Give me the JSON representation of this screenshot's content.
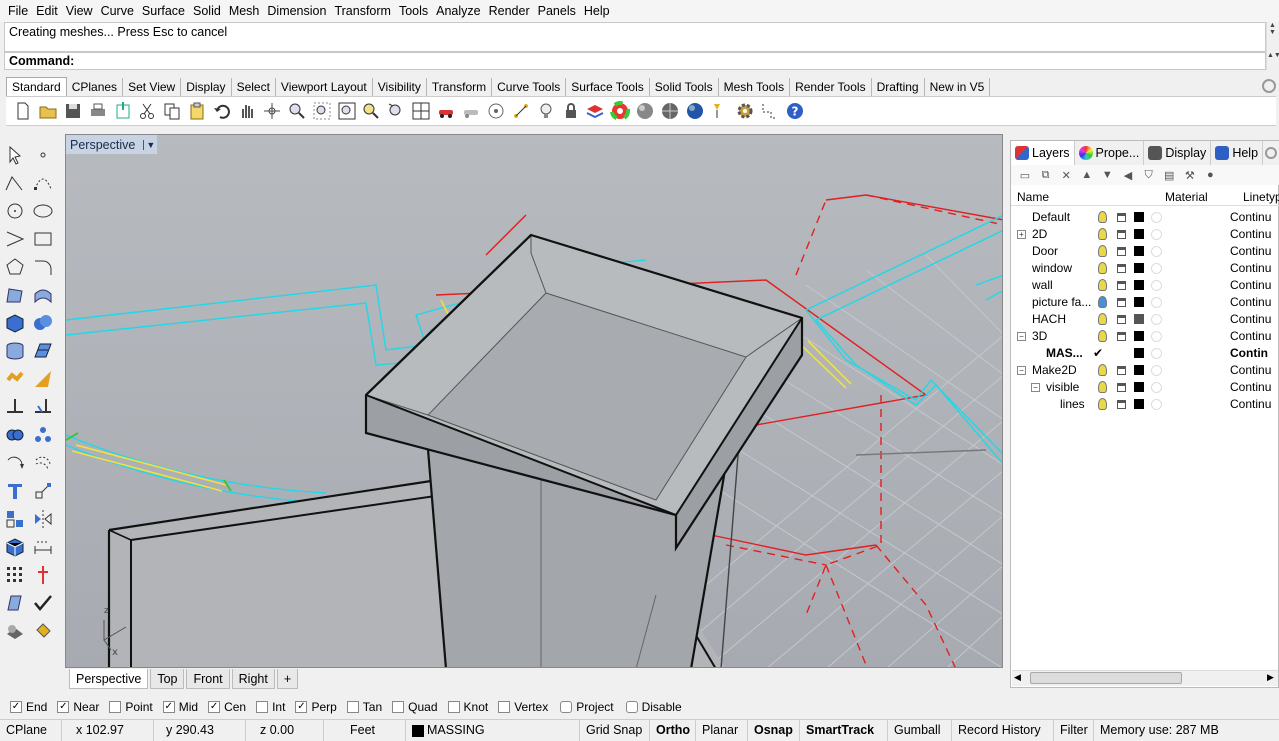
{
  "menu": [
    "File",
    "Edit",
    "View",
    "Curve",
    "Surface",
    "Solid",
    "Mesh",
    "Dimension",
    "Transform",
    "Tools",
    "Analyze",
    "Render",
    "Panels",
    "Help"
  ],
  "command_history": "Creating meshes... Press Esc to cancel",
  "command_prompt": "Command:",
  "toolbar_tabs": [
    "Standard",
    "CPlanes",
    "Set View",
    "Display",
    "Select",
    "Viewport Layout",
    "Visibility",
    "Transform",
    "Curve Tools",
    "Surface Tools",
    "Solid Tools",
    "Mesh Tools",
    "Render Tools",
    "Drafting",
    "New in V5"
  ],
  "viewport": {
    "title": "Perspective",
    "axis_x": "x",
    "axis_z": "z"
  },
  "viewport_tabs": [
    "Perspective",
    "Top",
    "Front",
    "Right",
    "+"
  ],
  "panel_tabs": [
    "Layers",
    "Prope...",
    "Display",
    "Help"
  ],
  "layers_header": {
    "name": "Name",
    "material": "Material",
    "linetype": "Linetyp"
  },
  "layers": [
    {
      "name": "Default",
      "indent": 0,
      "expander": "",
      "linetype": "Continu",
      "bulb": "#e8d84a",
      "swatch": "#000000"
    },
    {
      "name": "2D",
      "indent": 0,
      "expander": "+",
      "linetype": "Continu",
      "bulb": "#e8d84a",
      "swatch": "#000000"
    },
    {
      "name": "Door",
      "indent": 0,
      "expander": "",
      "linetype": "Continu",
      "bulb": "#e8d84a",
      "swatch": "#000000"
    },
    {
      "name": "window",
      "indent": 0,
      "expander": "",
      "linetype": "Continu",
      "bulb": "#e8d84a",
      "swatch": "#000000"
    },
    {
      "name": "wall",
      "indent": 0,
      "expander": "",
      "linetype": "Continu",
      "bulb": "#e8d84a",
      "swatch": "#000000"
    },
    {
      "name": "picture fa...",
      "indent": 0,
      "expander": "",
      "linetype": "Continu",
      "bulb": "#4a90d8",
      "swatch": "#000000"
    },
    {
      "name": "HACH",
      "indent": 0,
      "expander": "",
      "linetype": "Continu",
      "bulb": "#e8d84a",
      "swatch": "#555555"
    },
    {
      "name": "3D",
      "indent": 0,
      "expander": "−",
      "linetype": "Continu",
      "bulb": "#e8d84a",
      "swatch": "#000000"
    },
    {
      "name": "MAS...",
      "indent": 1,
      "expander": "",
      "linetype": "Contin",
      "bulb": "",
      "swatch": "#000000",
      "current": true
    },
    {
      "name": "Make2D",
      "indent": 0,
      "expander": "−",
      "linetype": "Continu",
      "bulb": "#e8d84a",
      "swatch": "#000000"
    },
    {
      "name": "visible",
      "indent": 1,
      "expander": "−",
      "linetype": "Continu",
      "bulb": "#e8d84a",
      "swatch": "#000000"
    },
    {
      "name": "lines",
      "indent": 2,
      "expander": "",
      "linetype": "Continu",
      "bulb": "#e8d84a",
      "swatch": "#000000"
    }
  ],
  "osnaps": [
    {
      "label": "End",
      "checked": true
    },
    {
      "label": "Near",
      "checked": true
    },
    {
      "label": "Point",
      "checked": false
    },
    {
      "label": "Mid",
      "checked": true
    },
    {
      "label": "Cen",
      "checked": true
    },
    {
      "label": "Int",
      "checked": false
    },
    {
      "label": "Perp",
      "checked": true
    },
    {
      "label": "Tan",
      "checked": false
    },
    {
      "label": "Quad",
      "checked": false
    },
    {
      "label": "Knot",
      "checked": false
    },
    {
      "label": "Vertex",
      "checked": false
    },
    {
      "label": "Project",
      "checked": false
    },
    {
      "label": "Disable",
      "checked": false
    }
  ],
  "status": {
    "cplane": "CPlane",
    "x": "x 102.97",
    "y": "y 290.43",
    "z": "z 0.00",
    "units": "Feet",
    "layer": "MASSING",
    "grid_snap": "Grid Snap",
    "ortho": "Ortho",
    "planar": "Planar",
    "osnap": "Osnap",
    "smarttrack": "SmartTrack",
    "gumball": "Gumball",
    "record_history": "Record History",
    "filter": "Filter",
    "memory": "Memory use: 287 MB"
  },
  "colors": {
    "cyan": "#1fd8e8",
    "red": "#e02020",
    "yellow": "#f0e040",
    "viewport_bg": "#aeb2b7"
  }
}
